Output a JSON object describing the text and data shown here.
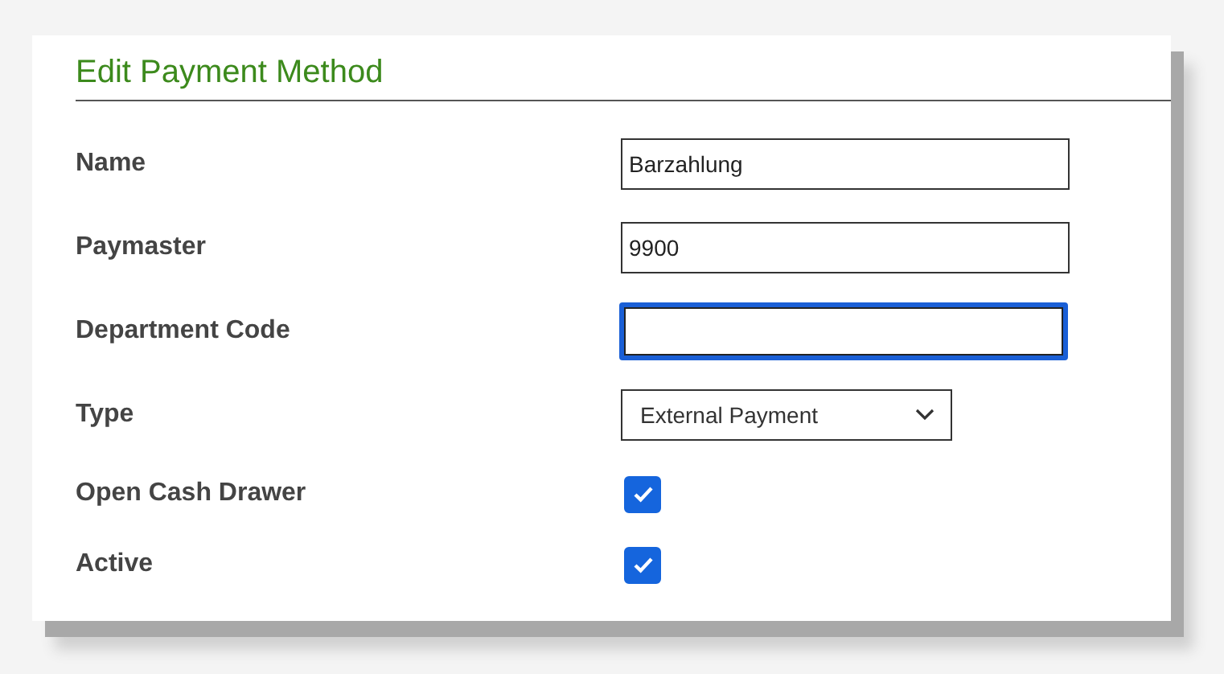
{
  "title": "Edit Payment Method",
  "fields": [
    {
      "label": "Name",
      "kind": "text",
      "value": "Barzahlung",
      "focused": false
    },
    {
      "label": "Paymaster",
      "kind": "text",
      "value": "9900",
      "focused": false
    },
    {
      "label": "Department Code",
      "kind": "text",
      "focused": true
    },
    {
      "label": "Type",
      "kind": "select",
      "value": "External Payment"
    },
    {
      "label": "Open Cash Drawer",
      "kind": "checkbox",
      "checked": true
    },
    {
      "label": "Active",
      "kind": "checkbox",
      "checked": true
    }
  ]
}
